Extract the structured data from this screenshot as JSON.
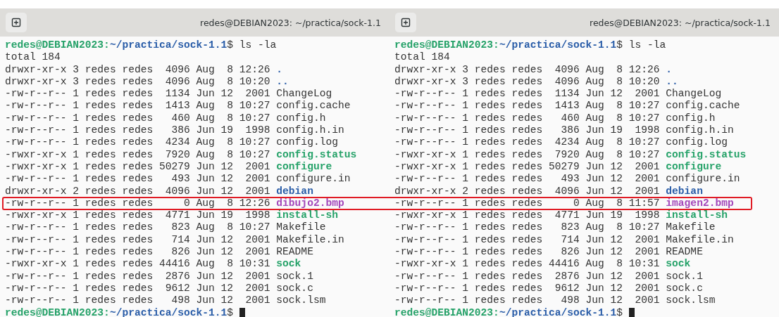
{
  "terminals": [
    {
      "title": "redes@DEBIAN2023: ~/practica/sock-1.1",
      "prompt": {
        "user_host": "redes@DEBIAN2023:",
        "path": "~/practica/sock-1.1",
        "command": "$ ls -la"
      },
      "total": "total 184",
      "rows": [
        {
          "meta": "drwxr-xr-x 3 redes redes  4096 Aug  8 12:26",
          "name": ".",
          "kind": "dir",
          "highlighted": false
        },
        {
          "meta": "drwxr-xr-x 3 redes redes  4096 Aug  8 10:20",
          "name": "..",
          "kind": "dir",
          "highlighted": false
        },
        {
          "meta": "-rw-r--r-- 1 redes redes  1134 Jun 12  2001",
          "name": "ChangeLog",
          "kind": "file",
          "highlighted": false
        },
        {
          "meta": "-rw-r--r-- 1 redes redes  1413 Aug  8 10:27",
          "name": "config.cache",
          "kind": "file",
          "highlighted": false
        },
        {
          "meta": "-rw-r--r-- 1 redes redes   460 Aug  8 10:27",
          "name": "config.h",
          "kind": "file",
          "highlighted": false
        },
        {
          "meta": "-rw-r--r-- 1 redes redes   386 Jun 19  1998",
          "name": "config.h.in",
          "kind": "file",
          "highlighted": false
        },
        {
          "meta": "-rw-r--r-- 1 redes redes  4234 Aug  8 10:27",
          "name": "config.log",
          "kind": "file",
          "highlighted": false
        },
        {
          "meta": "-rwxr-xr-x 1 redes redes  7920 Aug  8 10:27",
          "name": "config.status",
          "kind": "exec",
          "highlighted": false
        },
        {
          "meta": "-rwxr-xr-x 1 redes redes 50279 Jun 12  2001",
          "name": "configure",
          "kind": "exec",
          "highlighted": false
        },
        {
          "meta": "-rw-r--r-- 1 redes redes   493 Jun 12  2001",
          "name": "configure.in",
          "kind": "file",
          "highlighted": false
        },
        {
          "meta": "drwxr-xr-x 2 redes redes  4096 Jun 12  2001",
          "name": "debian",
          "kind": "dir",
          "highlighted": false
        },
        {
          "meta": "-rw-r--r-- 1 redes redes     0 Aug  8 12:26",
          "name": "dibujo2.bmp",
          "kind": "image",
          "highlighted": true
        },
        {
          "meta": "-rwxr-xr-x 1 redes redes  4771 Jun 19  1998",
          "name": "install-sh",
          "kind": "exec",
          "highlighted": false
        },
        {
          "meta": "-rw-r--r-- 1 redes redes   823 Aug  8 10:27",
          "name": "Makefile",
          "kind": "file",
          "highlighted": false
        },
        {
          "meta": "-rw-r--r-- 1 redes redes   714 Jun 12  2001",
          "name": "Makefile.in",
          "kind": "file",
          "highlighted": false
        },
        {
          "meta": "-rw-r--r-- 1 redes redes   826 Jun 12  2001",
          "name": "README",
          "kind": "file",
          "highlighted": false
        },
        {
          "meta": "-rwxr-xr-x 1 redes redes 44416 Aug  8 10:31",
          "name": "sock",
          "kind": "exec",
          "highlighted": false
        },
        {
          "meta": "-rw-r--r-- 1 redes redes  2876 Jun 12  2001",
          "name": "sock.1",
          "kind": "file",
          "highlighted": false
        },
        {
          "meta": "-rw-r--r-- 1 redes redes  9612 Jun 12  2001",
          "name": "sock.c",
          "kind": "file",
          "highlighted": false
        },
        {
          "meta": "-rw-r--r-- 1 redes redes   498 Jun 12  2001",
          "name": "sock.lsm",
          "kind": "file",
          "highlighted": false
        }
      ],
      "end_prompt": {
        "user_host": "redes@DEBIAN2023:",
        "path": "~/practica/sock-1.1",
        "command": "$"
      }
    },
    {
      "title": "redes@DEBIAN2023: ~/practica/sock-1.1",
      "prompt": {
        "user_host": "redes@DEBIAN2023:",
        "path": "~/practica/sock-1.1",
        "command": "$ ls -la"
      },
      "total": "total 184",
      "rows": [
        {
          "meta": "drwxr-xr-x 3 redes redes  4096 Aug  8 12:26",
          "name": ".",
          "kind": "dir",
          "highlighted": false
        },
        {
          "meta": "drwxr-xr-x 3 redes redes  4096 Aug  8 10:20",
          "name": "..",
          "kind": "dir",
          "highlighted": false
        },
        {
          "meta": "-rw-r--r-- 1 redes redes  1134 Jun 12  2001",
          "name": "ChangeLog",
          "kind": "file",
          "highlighted": false
        },
        {
          "meta": "-rw-r--r-- 1 redes redes  1413 Aug  8 10:27",
          "name": "config.cache",
          "kind": "file",
          "highlighted": false
        },
        {
          "meta": "-rw-r--r-- 1 redes redes   460 Aug  8 10:27",
          "name": "config.h",
          "kind": "file",
          "highlighted": false
        },
        {
          "meta": "-rw-r--r-- 1 redes redes   386 Jun 19  1998",
          "name": "config.h.in",
          "kind": "file",
          "highlighted": false
        },
        {
          "meta": "-rw-r--r-- 1 redes redes  4234 Aug  8 10:27",
          "name": "config.log",
          "kind": "file",
          "highlighted": false
        },
        {
          "meta": "-rwxr-xr-x 1 redes redes  7920 Aug  8 10:27",
          "name": "config.status",
          "kind": "exec",
          "highlighted": false
        },
        {
          "meta": "-rwxr-xr-x 1 redes redes 50279 Jun 12  2001",
          "name": "configure",
          "kind": "exec",
          "highlighted": false
        },
        {
          "meta": "-rw-r--r-- 1 redes redes   493 Jun 12  2001",
          "name": "configure.in",
          "kind": "file",
          "highlighted": false
        },
        {
          "meta": "drwxr-xr-x 2 redes redes  4096 Jun 12  2001",
          "name": "debian",
          "kind": "dir",
          "highlighted": false
        },
        {
          "meta": "-rw-r--r-- 1 redes redes     0 Aug  8 11:57",
          "name": "imagen2.bmp",
          "kind": "image",
          "highlighted": true
        },
        {
          "meta": "-rwxr-xr-x 1 redes redes  4771 Jun 19  1998",
          "name": "install-sh",
          "kind": "exec",
          "highlighted": false
        },
        {
          "meta": "-rw-r--r-- 1 redes redes   823 Aug  8 10:27",
          "name": "Makefile",
          "kind": "file",
          "highlighted": false
        },
        {
          "meta": "-rw-r--r-- 1 redes redes   714 Jun 12  2001",
          "name": "Makefile.in",
          "kind": "file",
          "highlighted": false
        },
        {
          "meta": "-rw-r--r-- 1 redes redes   826 Jun 12  2001",
          "name": "README",
          "kind": "file",
          "highlighted": false
        },
        {
          "meta": "-rwxr-xr-x 1 redes redes 44416 Aug  8 10:31",
          "name": "sock",
          "kind": "exec",
          "highlighted": false
        },
        {
          "meta": "-rw-r--r-- 1 redes redes  2876 Jun 12  2001",
          "name": "sock.1",
          "kind": "file",
          "highlighted": false
        },
        {
          "meta": "-rw-r--r-- 1 redes redes  9612 Jun 12  2001",
          "name": "sock.c",
          "kind": "file",
          "highlighted": false
        },
        {
          "meta": "-rw-r--r-- 1 redes redes   498 Jun 12  2001",
          "name": "sock.lsm",
          "kind": "file",
          "highlighted": false
        }
      ],
      "end_prompt": {
        "user_host": "redes@DEBIAN2023:",
        "path": "~/practica/sock-1.1",
        "command": "$"
      }
    }
  ]
}
